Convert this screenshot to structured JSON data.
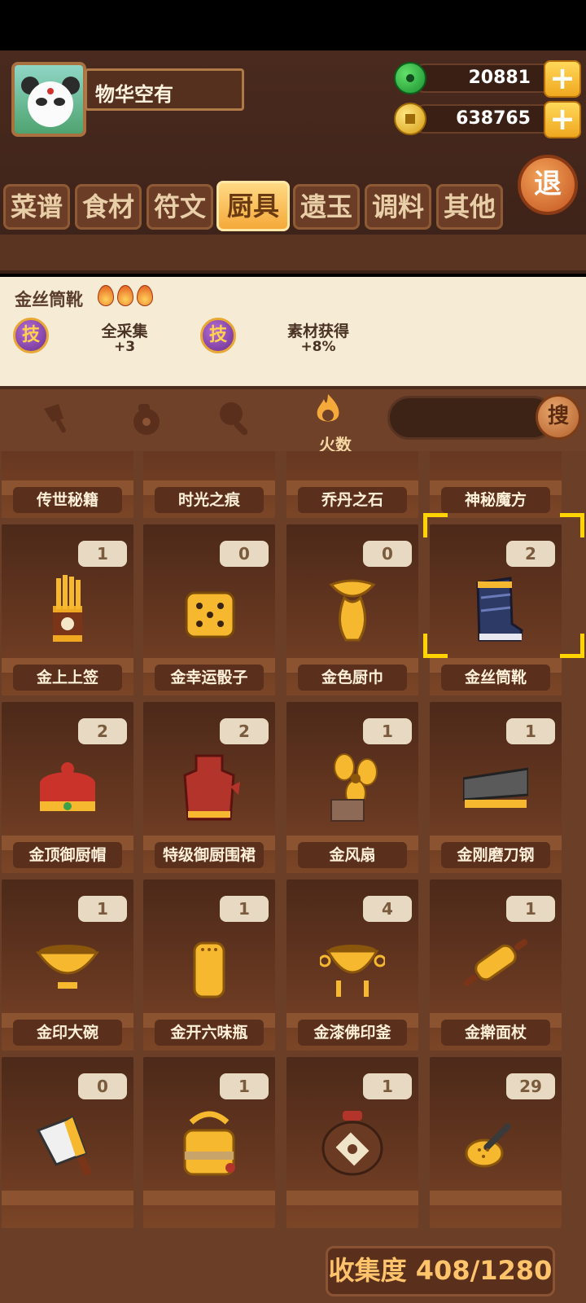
{
  "player": {
    "name": "物华空有"
  },
  "currency": {
    "jade": "20881",
    "coins": "638765",
    "add_label": "+"
  },
  "exit_label": "退",
  "tabs": [
    {
      "label": "菜谱"
    },
    {
      "label": "食材"
    },
    {
      "label": "符文"
    },
    {
      "label": "厨具",
      "active": true
    },
    {
      "label": "遗玉"
    },
    {
      "label": "调料"
    },
    {
      "label": "其他"
    }
  ],
  "detail": {
    "title": "金丝筒靴",
    "flame_count": 3,
    "skills": [
      {
        "badge": "技",
        "name": "全采集",
        "value": "+3"
      },
      {
        "badge": "技",
        "name": "素材获得",
        "value": "+8%"
      }
    ]
  },
  "filters": {
    "fire_label": "火数",
    "search_button": "搜",
    "search_value": ""
  },
  "rows": [
    [
      {
        "name": "传世秘籍"
      },
      {
        "name": "时光之痕"
      },
      {
        "name": "乔丹之石"
      },
      {
        "name": "神秘魔方"
      }
    ],
    [
      {
        "name": "金上上签",
        "count": "1"
      },
      {
        "name": "金幸运骰子",
        "count": "0"
      },
      {
        "name": "金色厨巾",
        "count": "0"
      },
      {
        "name": "金丝筒靴",
        "count": "2"
      }
    ],
    [
      {
        "name": "金顶御厨帽",
        "count": "2"
      },
      {
        "name": "特级御厨围裙",
        "count": "2"
      },
      {
        "name": "金风扇",
        "count": "1"
      },
      {
        "name": "金刚磨刀钢",
        "count": "1"
      }
    ],
    [
      {
        "name": "金印大碗",
        "count": "1"
      },
      {
        "name": "金开六味瓶",
        "count": "1"
      },
      {
        "name": "金漆佛印釜",
        "count": "4"
      },
      {
        "name": "金擀面杖",
        "count": "1"
      }
    ],
    [
      {
        "name": "",
        "count": "0"
      },
      {
        "name": "",
        "count": "1"
      },
      {
        "name": "",
        "count": "1"
      },
      {
        "name": "",
        "count": "29"
      }
    ]
  ],
  "collection": {
    "label": "收集度 408/1280"
  },
  "colors": {
    "gold": "#f5a93a",
    "wood": "#6b3e27",
    "panel": "#f6ecd6",
    "selector": "#ffd400"
  }
}
